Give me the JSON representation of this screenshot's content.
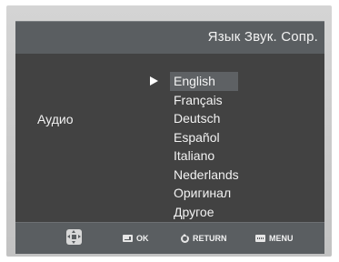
{
  "header": {
    "title": "Язык Звук. Сопр."
  },
  "setting": {
    "label": "Аудио"
  },
  "menu": {
    "selected_index": 0,
    "options": [
      "English",
      "Français",
      "Deutsch",
      "Español",
      "Italiano",
      "Nederlands",
      "Оригинал",
      "Другое"
    ]
  },
  "footer": {
    "nav_icon": "directional-pad-icon",
    "ok_label": "OK",
    "return_label": "RETURN",
    "menu_label": "MENU"
  },
  "colors": {
    "panel_bg": "#424242",
    "bar_bg": "#5a5e61",
    "highlight_bg": "#5e6164",
    "text": "#f2f2f2",
    "bezel": "#c8c8c8"
  }
}
